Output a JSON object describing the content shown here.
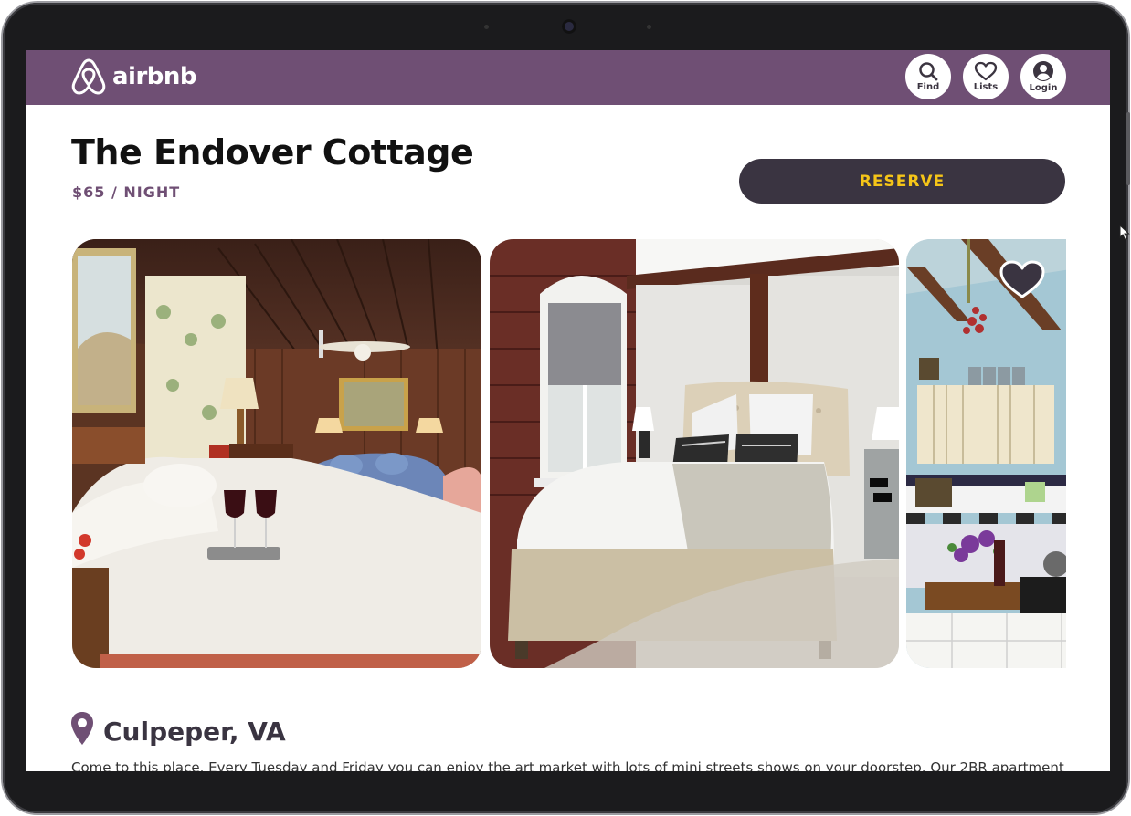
{
  "header": {
    "logo_text": "airbnb",
    "nav": [
      {
        "label": "Find",
        "icon": "search-icon"
      },
      {
        "label": "Lists",
        "icon": "heart-icon"
      },
      {
        "label": "Login",
        "icon": "user-icon"
      }
    ]
  },
  "listing": {
    "title": "The Endover Cottage",
    "price": "$65 / NIGHT",
    "reserve_label": "RESERVE",
    "location": "Culpeper, VA",
    "description": "Come to this place. Every Tuesday and Friday you can enjoy the art market with lots of mini streets shows on your doorstep. Our 2BR apartment"
  },
  "gallery": {
    "photos": [
      "bedroom-wood-paneled",
      "bedroom-brick-wall",
      "kitchen"
    ]
  },
  "colors": {
    "header_bg": "#6f4f74",
    "reserve_bg": "#3a3441",
    "reserve_text": "#f5c518",
    "accent": "#6f4f74"
  }
}
